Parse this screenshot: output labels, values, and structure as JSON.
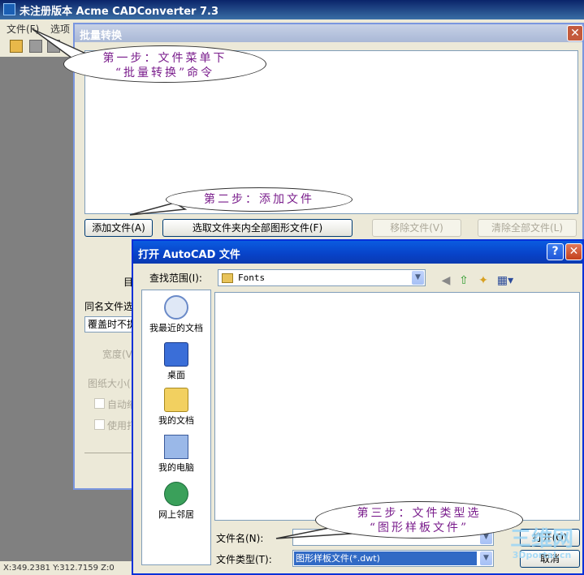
{
  "app": {
    "title": "未注册版本 Acme CADConverter 7.3",
    "menu": [
      "文件(F)",
      "选项"
    ],
    "status": "X:349.2381 Y:312.7159 Z:0"
  },
  "batch_dialog": {
    "title": "批量转换",
    "buttons": {
      "add_file": "添加文件(A)",
      "select_all_in_folder": "选取文件夹内全部图形文件(F)",
      "remove_file": "移除文件(V)",
      "clear_all": "清除全部文件(L)"
    },
    "labels": {
      "dir_partial": "目",
      "same_name_partial": "同名文件选",
      "overwrite_partial": "覆盖时不提",
      "width_partial": "宽度(V",
      "paper_size_partial": "图纸大小(",
      "auto_partial": "自动缩",
      "use_partial": "使用打"
    }
  },
  "open_dialog": {
    "title": "打开 AutoCAD 文件",
    "look_in_label": "查找范围(I):",
    "look_in_value": "Fonts",
    "places": [
      "我最近的文档",
      "桌面",
      "我的文档",
      "我的电脑",
      "网上邻居"
    ],
    "filename_label": "文件名(N):",
    "filename_value": "",
    "filetype_label": "文件类型(T):",
    "filetype_value": "图形样板文件(*.dwt)",
    "open_button": "打开(O)",
    "cancel_button": "取消"
  },
  "callouts": {
    "step1": [
      "第一步：文件菜单下",
      "“批量转换”命令"
    ],
    "step2": "第二步：添加文件",
    "step3": [
      "第三步：文件类型选",
      "“图形样板文件”"
    ]
  },
  "watermark": [
    "三维网",
    "3Dportal.cn"
  ]
}
